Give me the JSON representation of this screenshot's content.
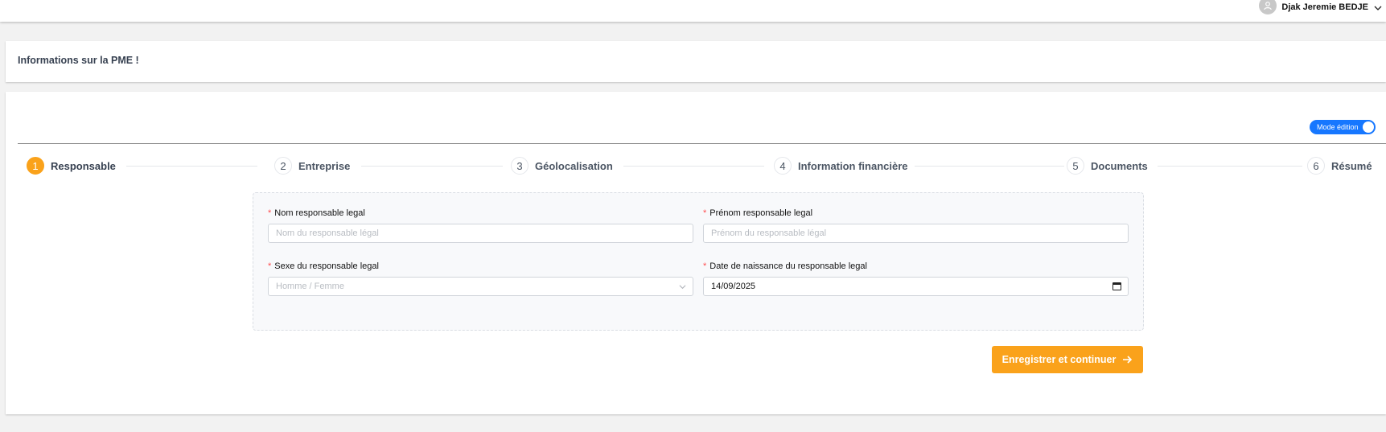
{
  "header": {
    "user_name": "Djak Jeremie BEDJE",
    "avatar_icon": "user-icon",
    "dropdown_icon": "chevron-down-icon"
  },
  "page": {
    "title": "Informations sur la PME !"
  },
  "mode_toggle": {
    "label": "Mode édition",
    "on": true
  },
  "steps": [
    {
      "number": "1",
      "label": "Responsable",
      "active": true
    },
    {
      "number": "2",
      "label": "Entreprise",
      "active": false
    },
    {
      "number": "3",
      "label": "Géolocalisation",
      "active": false
    },
    {
      "number": "4",
      "label": "Information financière",
      "active": false
    },
    {
      "number": "5",
      "label": "Documents",
      "active": false
    },
    {
      "number": "6",
      "label": "Résumé",
      "active": false
    }
  ],
  "form": {
    "required_marker": "*",
    "nom": {
      "label": "Nom responsable legal",
      "placeholder": "Nom du responsable légal"
    },
    "prenom": {
      "label": "Prénom responsable legal",
      "placeholder": "Prénom du responsable légal"
    },
    "sexe": {
      "label": "Sexe du responsable legal",
      "placeholder": "Homme / Femme"
    },
    "date": {
      "label": "Date de naissance du responsable legal",
      "value": "14/09/2025"
    }
  },
  "submit": {
    "label": "Enregistrer et continuer",
    "icon": "arrow-right-icon"
  },
  "colors": {
    "accent": "#faa21b",
    "toggle": "#1677ff",
    "required": "#ff4d4f"
  }
}
